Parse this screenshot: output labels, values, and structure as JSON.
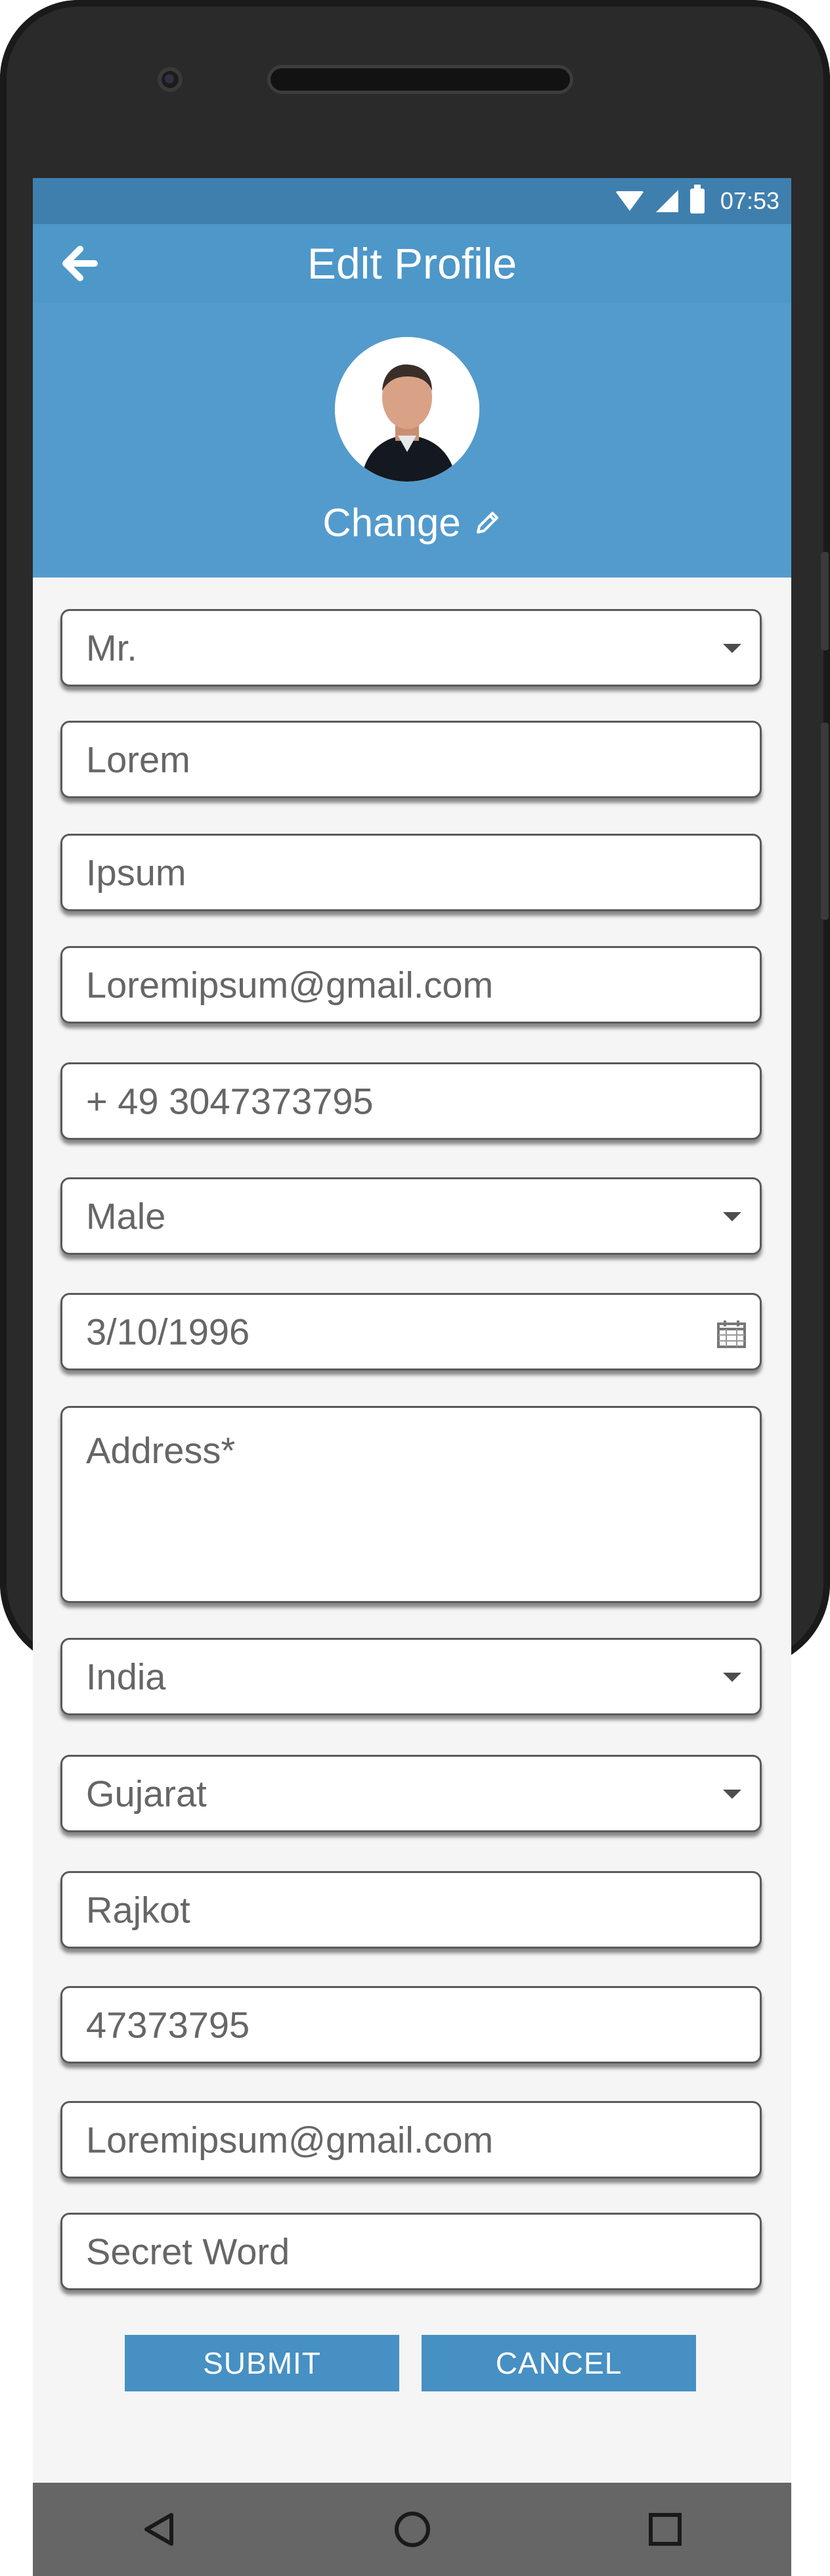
{
  "status_bar": {
    "time": "07:53"
  },
  "app_bar": {
    "title": "Edit Profile"
  },
  "profile": {
    "change_label": "Change"
  },
  "form": {
    "fields": [
      {
        "name": "salutation-select",
        "value": "Mr.",
        "type": "select"
      },
      {
        "name": "first-name-input",
        "value": "Lorem",
        "type": "text"
      },
      {
        "name": "last-name-input",
        "value": "Ipsum",
        "type": "text"
      },
      {
        "name": "email-input",
        "value": "Loremipsum@gmail.com",
        "type": "text"
      },
      {
        "name": "phone-input",
        "value": "+ 49 3047373795",
        "type": "text"
      },
      {
        "name": "gender-select",
        "value": "Male",
        "type": "select"
      },
      {
        "name": "birthdate-input",
        "value": "3/10/1996",
        "type": "date"
      },
      {
        "name": "address-textarea",
        "placeholder": "Address*",
        "type": "textarea"
      },
      {
        "name": "country-select",
        "value": "India",
        "type": "select"
      },
      {
        "name": "state-select",
        "value": "Gujarat",
        "type": "select"
      },
      {
        "name": "city-input",
        "value": "Rajkot",
        "type": "text"
      },
      {
        "name": "zip-input",
        "value": "47373795",
        "type": "text"
      },
      {
        "name": "secondary-email-input",
        "value": "Loremipsum@gmail.com",
        "type": "text"
      },
      {
        "name": "secret-word-input",
        "placeholder": "Secret Word",
        "type": "text"
      }
    ],
    "submit_label": "SUBMIT",
    "cancel_label": "CANCEL"
  },
  "icons": [
    "back-arrow-icon",
    "pencil-icon",
    "wifi-icon",
    "signal-icon",
    "battery-icon",
    "calendar-icon",
    "nav-back-icon",
    "nav-home-icon",
    "nav-recents-icon"
  ],
  "colors": {
    "status_bar": "#3f7fae",
    "app_bar": "#4d97c9",
    "button": "#4690c3",
    "nav_bar": "#666666"
  }
}
